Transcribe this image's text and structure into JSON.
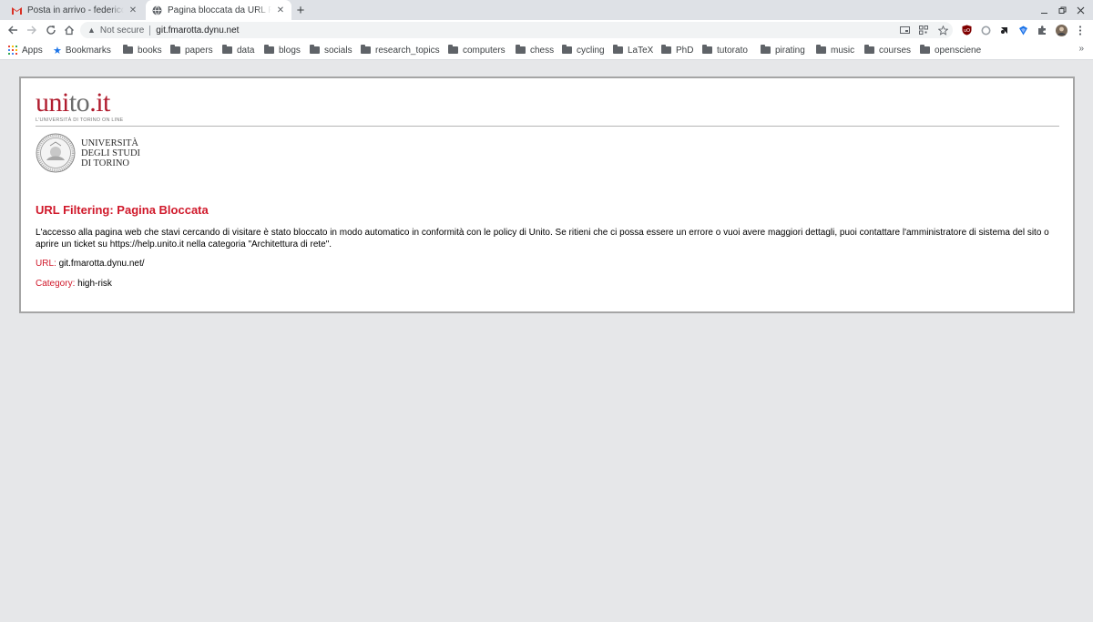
{
  "browser": {
    "tabs": [
      {
        "title": "Posta in arrivo - federico.m",
        "active": false,
        "favicon": "gmail-icon"
      },
      {
        "title": "Pagina bloccata da URL Filtering",
        "active": true,
        "favicon": "globe-icon"
      }
    ],
    "close_glyph": "✕",
    "new_tab_glyph": "+",
    "address": {
      "security_label": "Not secure",
      "url": "git.fmarotta.dynu.net"
    },
    "bookmarks": {
      "apps_label": "Apps",
      "bookmarks_label": "Bookmarks",
      "folders": [
        "books",
        "papers",
        "data",
        "blogs",
        "socials",
        "research_topics",
        "computers",
        "chess",
        "cycling",
        "LaTeX",
        "PhD",
        "tutorato",
        "pirating",
        "music",
        "courses",
        "opensciene"
      ],
      "overflow_glyph": "»"
    },
    "accent_color": "#1a73e8"
  },
  "page": {
    "logo": {
      "name_red_1": "uni",
      "name_dark": "to",
      "name_red_2": ".it",
      "tagline": "L'UNIVERSITÀ DI TORINO ON LINE"
    },
    "university": {
      "line1": "UNIVERSITÀ",
      "line2": "DEGLI STUDI",
      "line3": "DI TORINO"
    },
    "heading": "URL Filtering: Pagina Bloccata",
    "message": "L'accesso alla pagina web che stavi cercando di visitare è stato bloccato in modo automatico in conformità con le policy di Unito. Se ritieni che ci possa essere un errore o vuoi avere maggiori dettagli, puoi contattare l'amministratore di sistema del sito o aprire un ticket su https://help.unito.it nella categoria \"Architettura di rete\".",
    "url_label": "URL:",
    "url_value": "git.fmarotta.dynu.net/",
    "category_label": "Category:",
    "category_value": "high-risk",
    "accent_color": "#d0182a"
  }
}
